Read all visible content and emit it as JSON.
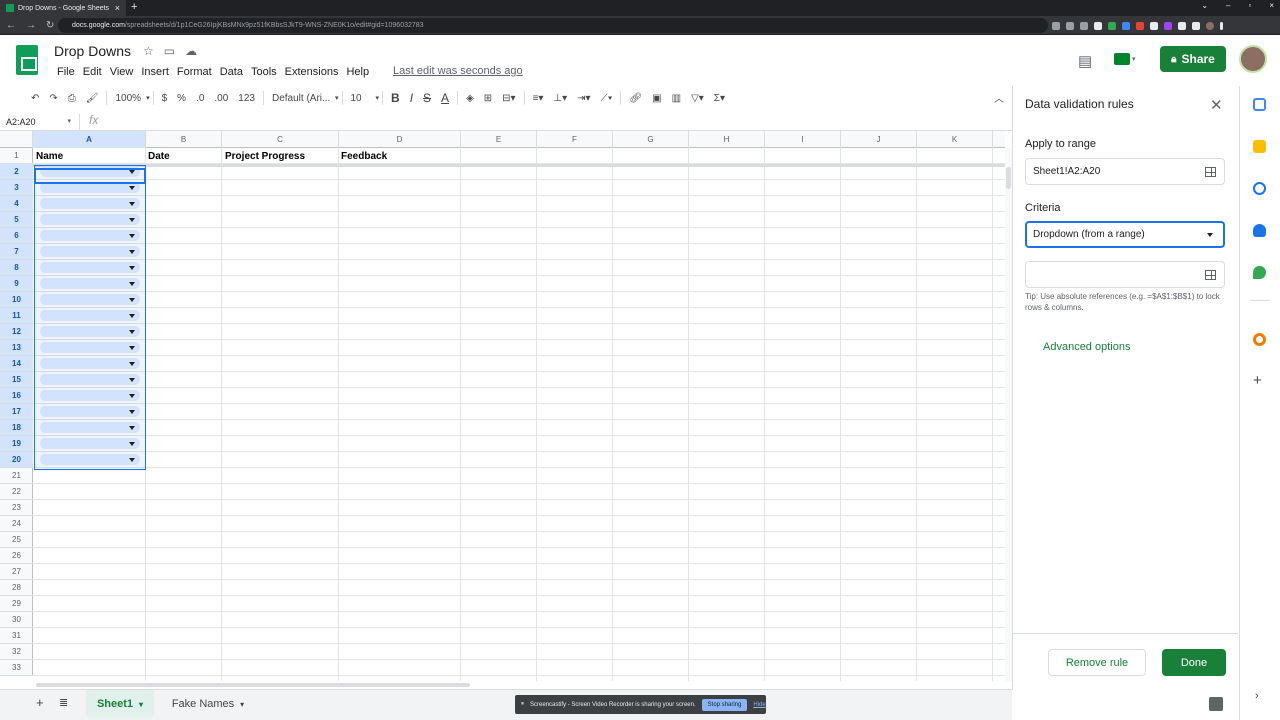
{
  "browser": {
    "tab_title": "Drop Downs - Google Sheets",
    "url_domain": "docs.google.com",
    "url_path": "/spreadsheets/d/1p1CeG26IpjKBsMNx9pz51fKBbsSJkT9-WNS-ZNE0K1o/edit#gid=1096032783"
  },
  "doc": {
    "title": "Drop Downs",
    "last_edit": "Last edit was seconds ago",
    "share_label": "Share"
  },
  "menu": [
    "File",
    "Edit",
    "View",
    "Insert",
    "Format",
    "Data",
    "Tools",
    "Extensions",
    "Help"
  ],
  "toolbar": {
    "zoom": "100%",
    "currency": "$",
    "percent": "%",
    "dec_less": ".0",
    "dec_more": ".00",
    "format_more": "123",
    "font": "Default (Ari...",
    "font_size": "10",
    "bold": "B",
    "italic": "I",
    "strike": "S",
    "text_color": "A"
  },
  "formula": {
    "namebox": "A2:A20",
    "fx": "fx"
  },
  "columns": [
    "A",
    "B",
    "C",
    "D",
    "E",
    "F",
    "G",
    "H",
    "I",
    "J",
    "K"
  ],
  "rows": [
    "1",
    "2",
    "3",
    "4",
    "5",
    "6",
    "7",
    "8",
    "9",
    "10",
    "11",
    "12",
    "13",
    "14",
    "15",
    "16",
    "17",
    "18",
    "19",
    "20",
    "21",
    "22",
    "23",
    "24",
    "25",
    "26",
    "27",
    "28",
    "29",
    "30",
    "31",
    "32",
    "33"
  ],
  "headers": {
    "a1": "Name",
    "b1": "Date",
    "c1": "Project Progress",
    "d1": "Feedback"
  },
  "sheets": {
    "tab1": "Sheet1",
    "tab2": "Fake Names"
  },
  "screencast": {
    "message": "Screencastify - Screen Video Recorder is sharing your screen.",
    "stop": "Stop sharing",
    "hide": "Hide"
  },
  "panel": {
    "title": "Data validation rules",
    "apply_label": "Apply to range",
    "range": "Sheet1!A2:A20",
    "criteria_label": "Criteria",
    "criteria_value": "Dropdown (from a range)",
    "range_value": "",
    "tip": "Tip: Use absolute references (e.g. =$A$1:$B$1) to lock rows & columns.",
    "advanced": "Advanced options",
    "remove": "Remove rule",
    "done": "Done"
  },
  "colors": {
    "brand_green": "#188038",
    "selection_blue": "#1a73e8",
    "chip_blue": "#d3e3fd"
  }
}
